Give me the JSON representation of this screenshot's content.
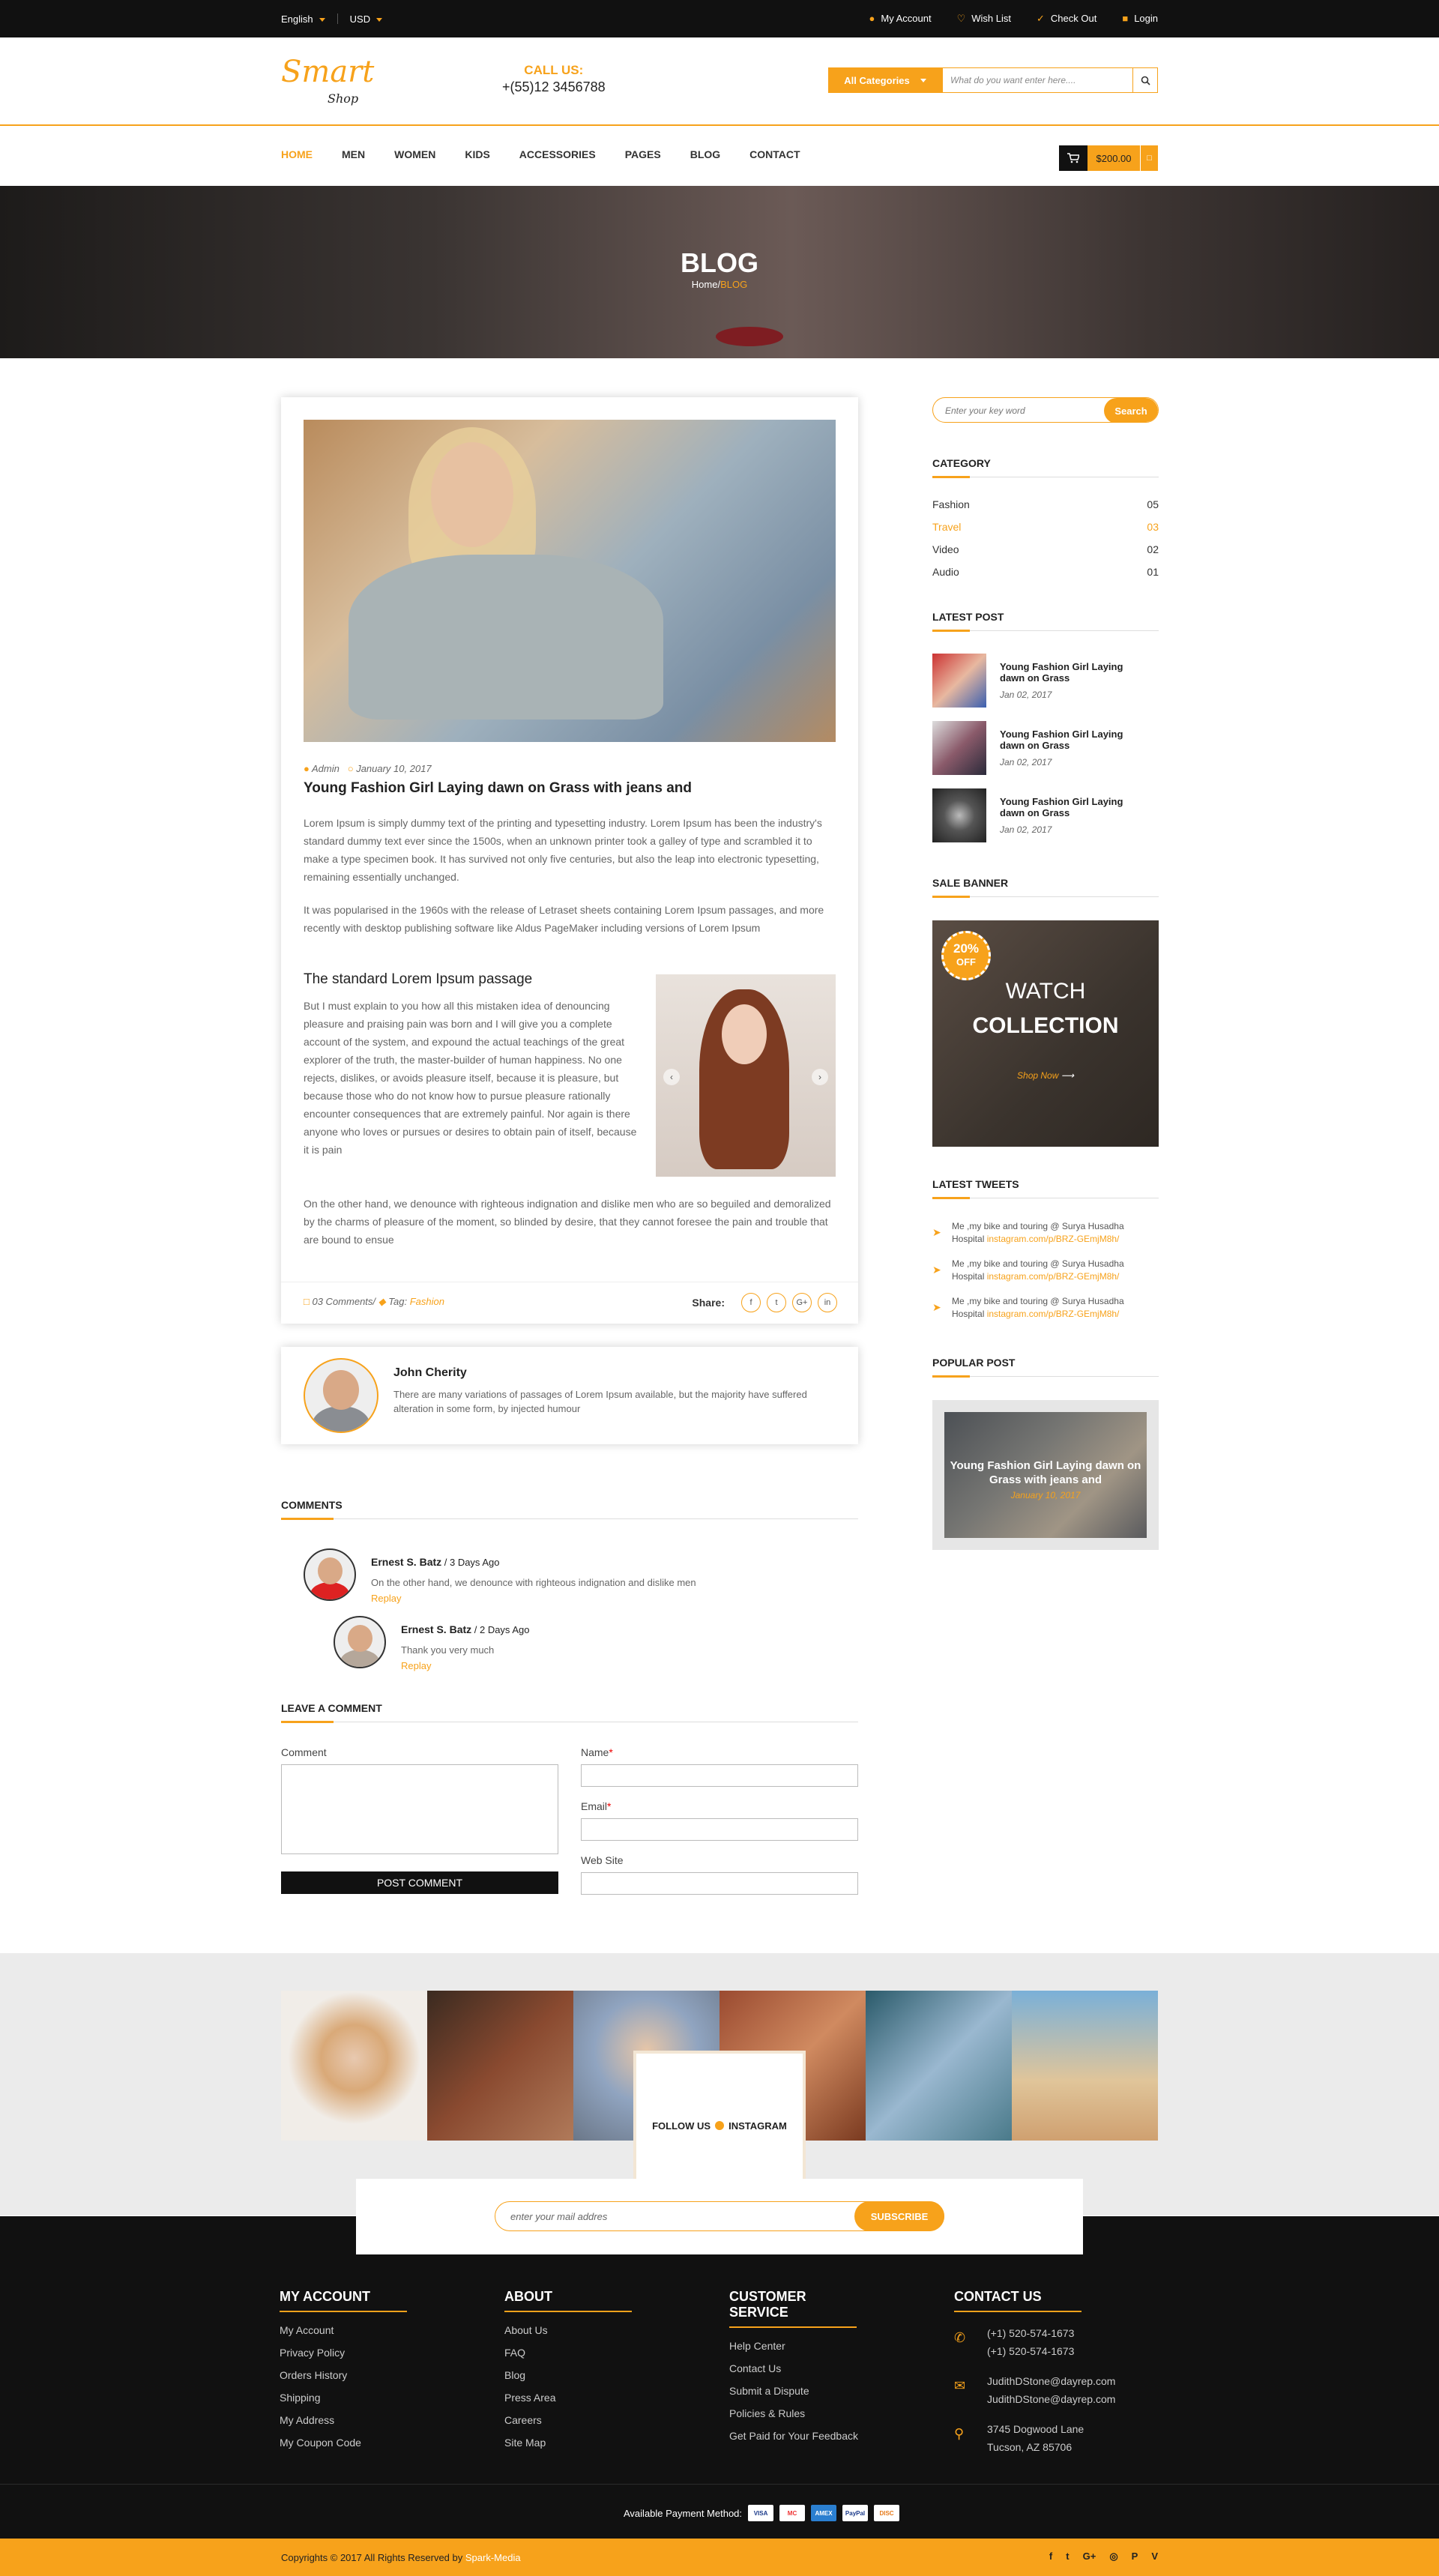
{
  "topbar": {
    "language": "English",
    "currency": "USD",
    "links": [
      {
        "icon": "user-icon",
        "label": "My Account"
      },
      {
        "icon": "heart-icon",
        "label": "Wish List"
      },
      {
        "icon": "check-icon",
        "label": "Check Out"
      },
      {
        "icon": "lock-icon",
        "label": "Login"
      }
    ]
  },
  "header": {
    "logo_main": "Smart",
    "logo_sub": "Shop",
    "call_label": "CALL US:",
    "phone": "+(55)12 3456788",
    "category_button": "All Categories",
    "search_placeholder": "What do you want enter here....",
    "search_icon": "magnifier-icon"
  },
  "nav": {
    "items": [
      "HOME",
      "MEN",
      "WOMEN",
      "KIDS",
      "ACCESSORIES",
      "PAGES",
      "BLOG",
      "CONTACT"
    ],
    "active": "HOME",
    "cart_total": "$200.00"
  },
  "hero": {
    "title": "BLOG",
    "breadcrumb_home": "Home/",
    "breadcrumb_current": "BLOG"
  },
  "post": {
    "author": "Admin",
    "date": "January 10, 2017",
    "title": "Young Fashion Girl Laying dawn on Grass with jeans and",
    "para1": "Lorem Ipsum is simply dummy text of the printing and typesetting industry. Lorem Ipsum has been the industry's standard dummy text ever since the 1500s, when an unknown printer took a galley of type and scrambled it to make a type specimen book. It has survived not only five centuries, but also the leap into electronic typesetting, remaining essentially unchanged.",
    "para2": "It was popularised in the 1960s with the release of Letraset sheets containing Lorem Ipsum passages, and more recently with desktop publishing software like Aldus PageMaker including versions of Lorem Ipsum",
    "subtitle": "The standard Lorem Ipsum passage",
    "para3": "But I must explain to you how all this mistaken idea of denouncing pleasure and praising pain was born and I will give you a complete account of the system, and expound the actual teachings of the great explorer of the truth, the master-builder of human happiness. No one rejects, dislikes, or avoids pleasure itself, because it is pleasure, but because those who do not know how to pursue pleasure rationally encounter consequences that are extremely painful. Nor again is there anyone who loves or pursues or desires to obtain pain of itself, because it is pain",
    "para4": "On the other hand, we denounce with righteous indignation and dislike men who are so beguiled and demoralized by the charms of pleasure of the moment, so blinded by desire, that they cannot foresee the pain and trouble that are bound to ensue",
    "comments_count": "03 Comments/",
    "tag_label": "Tag:",
    "tag_value": "Fashion",
    "share_label": "Share:",
    "share_icons": [
      "f",
      "t",
      "G+",
      "in"
    ]
  },
  "author_box": {
    "name": "John Cherity",
    "text": "There are many variations of passages of Lorem Ipsum available, but the majority have suffered alteration in some form, by injected humour"
  },
  "comments": {
    "heading": "COMMENTS",
    "items": [
      {
        "name": "Ernest S. Batz",
        "ago": " / 3 Days Ago",
        "text": "On the other hand, we denounce with righteous indignation and dislike men",
        "reply": "Replay"
      },
      {
        "name": "Ernest S. Batz",
        "ago": " / 2 Days Ago",
        "text": "Thank you very much",
        "reply": "Replay"
      }
    ]
  },
  "leave_comment": {
    "heading": "LEAVE A COMMENT",
    "comment_label": "Comment",
    "name_label": "Name",
    "email_label": "Email",
    "website_label": "Web Site",
    "required_mark": "*",
    "submit": "POST COMMENT"
  },
  "sidebar": {
    "search_placeholder": "Enter your key word",
    "search_button": "Search",
    "category_heading": "CATEGORY",
    "categories": [
      {
        "name": "Fashion",
        "count": "05"
      },
      {
        "name": "Travel",
        "count": "03"
      },
      {
        "name": "Video",
        "count": "02"
      },
      {
        "name": "Audio",
        "count": "01"
      }
    ],
    "latest_heading": "LATEST POST",
    "latest": [
      {
        "title": "Young Fashion Girl Laying dawn on Grass",
        "date": "Jan 02, 2017"
      },
      {
        "title": "Young Fashion Girl Laying dawn on Grass",
        "date": "Jan 02, 2017"
      },
      {
        "title": "Young Fashion Girl Laying dawn on Grass",
        "date": "Jan 02, 2017"
      }
    ],
    "banner_heading": "SALE BANNER",
    "banner_badge": "20%",
    "banner_badge_sub": "OFF",
    "banner_line1": "WATCH",
    "banner_line2": "COLLECTION",
    "banner_link": "Shop Now",
    "tweets_heading": "LATEST TWEETS",
    "tweets": [
      {
        "text": "Me ,my bike and touring @ Surya Husadha Hospital ",
        "link": "instagram.com/p/BRZ-GEmjM8h/"
      },
      {
        "text": "Me ,my bike and touring @ Surya Husadha Hospital ",
        "link": "instagram.com/p/BRZ-GEmjM8h/"
      },
      {
        "text": "Me ,my bike and touring @ Surya Husadha Hospital ",
        "link": "instagram.com/p/BRZ-GEmjM8h/"
      }
    ],
    "popular_heading": "POPULAR POST",
    "popular_title": "Young Fashion Girl Laying dawn on Grass with jeans and",
    "popular_date": "January 10, 2017"
  },
  "instagram": {
    "follow": "FOLLOW US",
    "name": "INSTAGRAM"
  },
  "newsletter": {
    "placeholder": "enter your mail addres",
    "button": "SUBSCRIBE"
  },
  "footer": {
    "account_heading": "MY ACCOUNT",
    "account": [
      "My Account",
      "Privacy Policy",
      "Orders History",
      "Shipping",
      "My Address",
      "My Coupon Code"
    ],
    "about_heading": "ABOUT",
    "about": [
      "About Us",
      "FAQ",
      "Blog",
      "Press Area",
      "Careers",
      "Site Map"
    ],
    "service_heading": "CUSTOMER SERVICE",
    "service": [
      "Help Center",
      "Contact Us",
      "Submit a Dispute",
      "Policies & Rules",
      "Get Paid for Your Feedback"
    ],
    "contact_heading": "CONTACT US",
    "phone1": "(+1) 520-574-1673",
    "phone2": "(+1) 520-574-1673",
    "email1": "JudithDStone@dayrep.com",
    "email2": "JudithDStone@dayrep.com",
    "address1": "3745 Dogwood Lane",
    "address2": "Tucson, AZ 85706",
    "payment_label": "Available Payment Method:",
    "payments": [
      "VISA",
      "MC",
      "AMEX",
      "PayPal",
      "DISC"
    ],
    "copyright": "Copyrights © 2017 All Rights Reserved by ",
    "copyright_brand": "Spark-Media",
    "social": [
      "f",
      "t",
      "G+",
      "◎",
      "P",
      "V"
    ]
  },
  "colors": {
    "accent": "#f7a21b",
    "dark": "#111111"
  }
}
